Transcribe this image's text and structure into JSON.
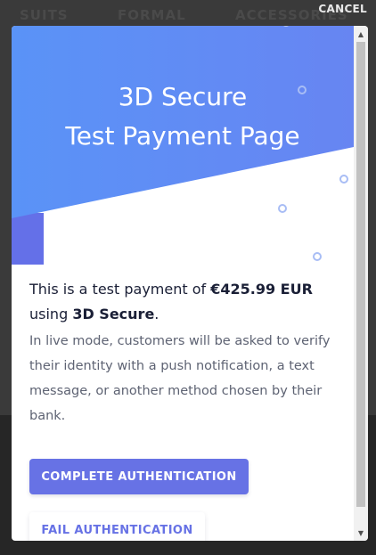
{
  "background": {
    "nav_items": [
      "SUITS",
      "FORMAL",
      "ACCESSORIES"
    ],
    "cancel_label": "CANCEL"
  },
  "modal": {
    "hero": {
      "title_line1": "3D Secure",
      "title_line2": "Test Payment Page"
    },
    "lead_prefix": "This is a test payment of ",
    "amount": "€425.99 EUR",
    "lead_middle": "using ",
    "method": "3D Secure",
    "lead_suffix": ".",
    "description": "In live mode, customers will be asked to verify their identity with a push notification, a text message, or another method chosen by their bank.",
    "complete_button": "COMPLETE AUTHENTICATION",
    "fail_button": "FAIL AUTHENTICATION"
  },
  "colors": {
    "accent": "#6772e5",
    "hero_blue": "#5b8ff9",
    "hero_dark": "#5f6ee0",
    "text_dark": "#1a1f36",
    "text_muted": "#5e6373"
  },
  "icons": {
    "scroll_up": "arrow-up-icon",
    "scroll_down": "arrow-down-icon"
  }
}
